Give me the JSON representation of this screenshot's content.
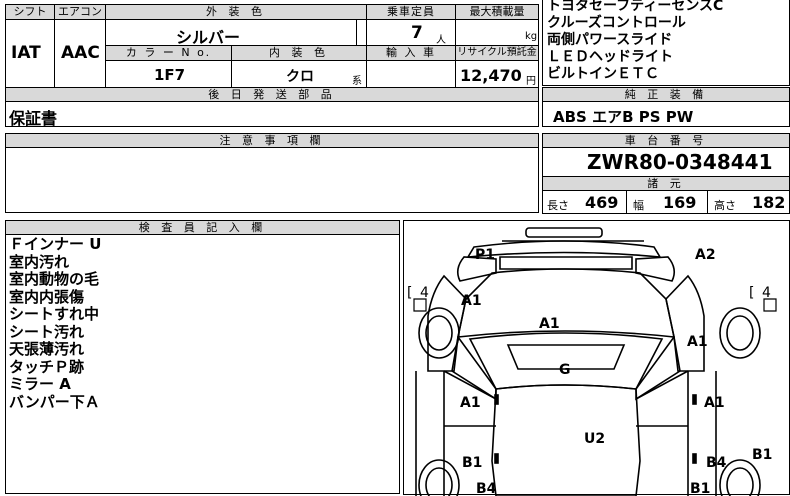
{
  "top_table": {
    "labels": {
      "shift": "シフト",
      "aircon": "エアコン",
      "exterior_color": "外 装 色",
      "capacity": "乗車定員",
      "max_load": "最大積載量",
      "color_no": "カ ラ ー N o.",
      "interior_color": "内 装 色",
      "import": "輸 入 車",
      "recycle": "リサイクル預託金",
      "later_parts": "後 日 発 送 部 品",
      "genuine_equipment": "純 正 装 備"
    },
    "values": {
      "shift": "IAT",
      "aircon": "AAC",
      "exterior_color": "シルバー",
      "capacity": "7",
      "capacity_unit": "人",
      "max_load_unit": "kg",
      "color_no": "1F7",
      "interior_color": "クロ",
      "interior_suffix": "系",
      "recycle_amount": "12,470",
      "recycle_unit": "円",
      "later_parts": "保証書",
      "genuine_equipment": "ABS エアB PS PW"
    }
  },
  "options": [
    "トヨタセーフティーセンスC",
    "クルーズコントロール",
    "両側パワースライド",
    "ＬＥＤヘッドライト",
    "ビルトインＥＴＣ"
  ],
  "caution": {
    "header": "注 意 事 項 欄"
  },
  "chassis": {
    "header": "車 台 番 号",
    "number": "ZWR80-0348441",
    "specs_header": "諸 元",
    "length_label": "長さ",
    "length": "469",
    "width_label": "幅",
    "width": "169",
    "height_label": "高さ",
    "height": "182"
  },
  "inspector": {
    "header": "検 査 員 記 入 欄",
    "notes": [
      "Ｆインナー U",
      "室内汚れ",
      "室内動物の毛",
      "室内内張傷",
      "シートすれ中",
      "シート汚れ",
      "天張薄汚れ",
      "タッチＰ跡",
      "ミラー A",
      "バンパー下Ａ"
    ]
  },
  "diagram": {
    "tire_left": "4",
    "tire_right": "4",
    "labels": {
      "p1": "P1",
      "a2": "A2",
      "a1_left_fender": "A1",
      "a1_hood": "A1",
      "a1_right_fender": "A1",
      "g": "G",
      "a1_left_door": "A1",
      "a1_right_door": "A1",
      "u2": "U2",
      "b1_left": "B1",
      "b4_right": "B4",
      "b1_far_right": "B1",
      "b4_bottom_left": "B4",
      "b1_bottom_right": "B1"
    }
  }
}
